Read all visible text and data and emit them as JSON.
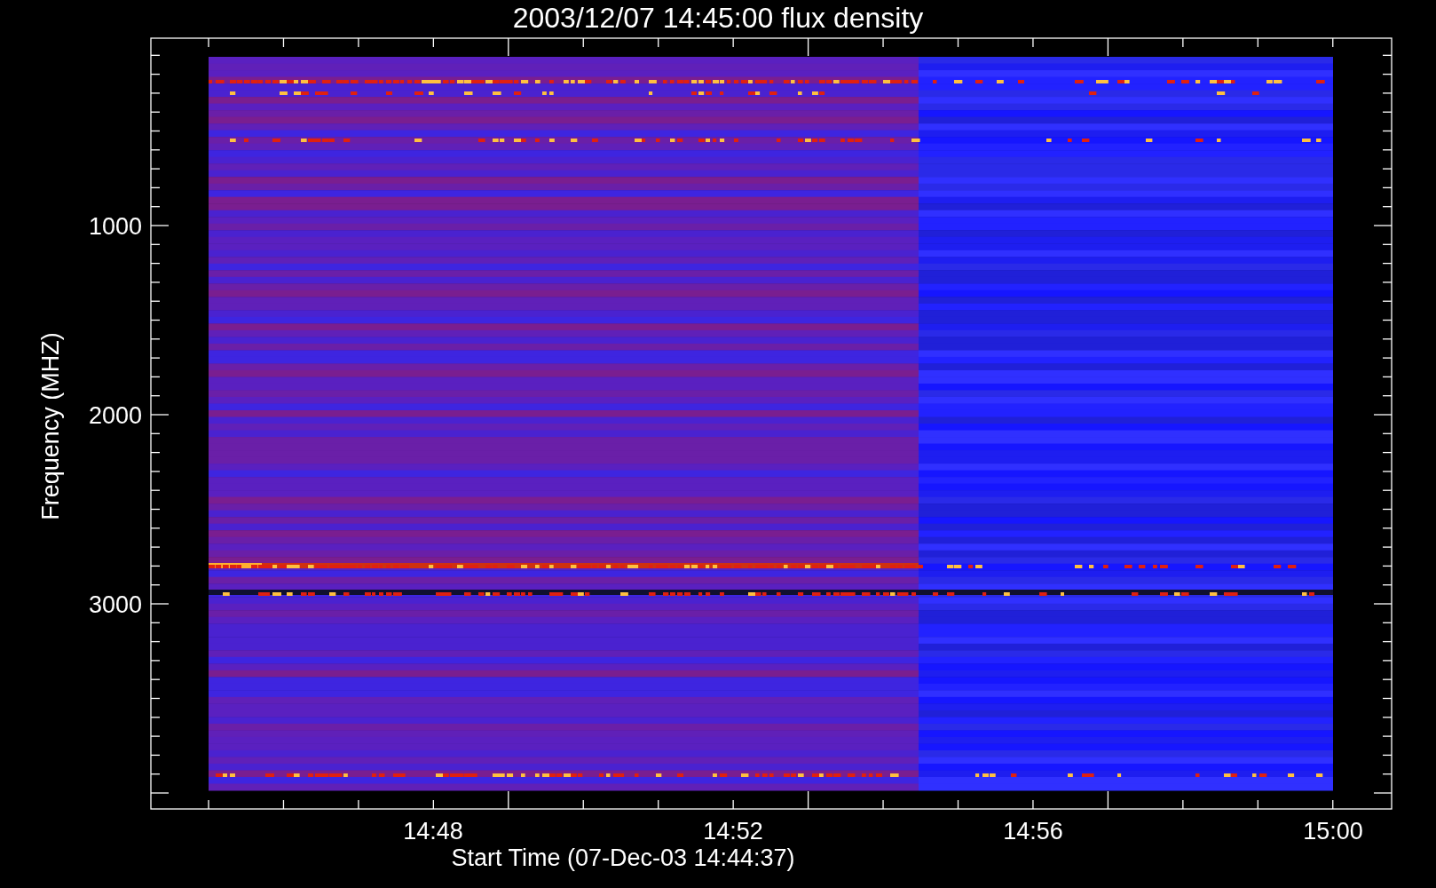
{
  "title": "2003/12/07 14:45:00 flux density",
  "y_axis": {
    "label": "Frequency (MHZ)",
    "ticks": [
      "1000",
      "2000",
      "3000"
    ]
  },
  "x_axis": {
    "label": "Start Time (07-Dec-03 14:44:37)",
    "ticks": [
      "14:48",
      "14:52",
      "14:56",
      "15:00"
    ]
  }
}
